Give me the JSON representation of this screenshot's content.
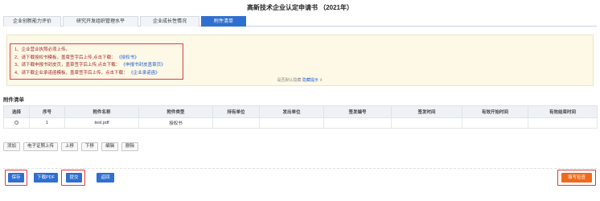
{
  "page": {
    "title": "高新技术企业认定申请书 （2021年）"
  },
  "tabs": [
    {
      "label": "企业创新能力评价",
      "active": false
    },
    {
      "label": "研究开发组织管理水平",
      "active": false
    },
    {
      "label": "企业成长性情况",
      "active": false
    },
    {
      "label": "附件清单",
      "active": true
    }
  ],
  "notice": {
    "line1": "1、企业营业执照必须上传。",
    "line2_text": "2、请下载授权书模板，盖章签字后上传,点击下载：",
    "line2_link": "《授权书》",
    "line3_text": "3、请下载申报书封皮页，盖章签字后上传,点击下载：",
    "line3_link": "《申报书封皮盖章页》",
    "line4_text": "4、请下载企业承诺函模板，盖章签字后上传，点击下载：",
    "line4_link": "《企业承诺函》",
    "toggle_text": "是否默认隐藏",
    "toggle_link": "隐藏提示",
    "toggle_arrow": "⇕"
  },
  "attachments": {
    "title": "附件清单",
    "columns": [
      "选择",
      "序号",
      "附件名称",
      "附件类型",
      "持有单位",
      "发出单位",
      "签发编号",
      "签发时间",
      "有效开始时间",
      "有效结束时间"
    ],
    "rows": [
      {
        "index": "1",
        "name": "test.pdf",
        "type": "授权书",
        "holder": "",
        "issuer": "",
        "number": "",
        "issue_date": "",
        "start": "",
        "end": ""
      }
    ]
  },
  "toolbar": {
    "add": "添加",
    "upload_cert": "电子证照上传",
    "move_up": "上移",
    "move_down": "下移",
    "edit": "编辑",
    "delete": "删除"
  },
  "footer": {
    "save": "保存",
    "download_pdf": "下载PDF",
    "submit": "提交",
    "back": "返回",
    "fill_check": "填写检查"
  },
  "colors": {
    "primary": "#2f6fcf",
    "accent_orange": "#f06a1b",
    "highlight_red": "#e03b3b",
    "notice_bg": "#fdf9e6"
  }
}
